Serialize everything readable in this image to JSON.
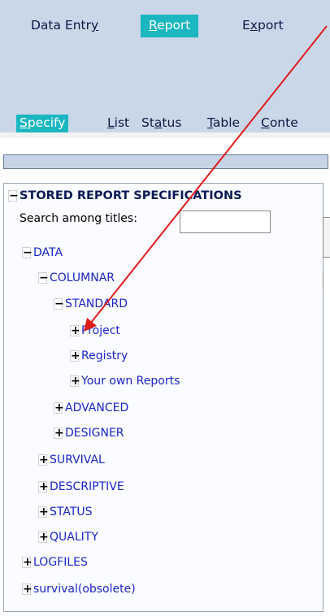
{
  "topnav": {
    "items": [
      {
        "pre": "Data Entr",
        "key": "y",
        "post": ""
      },
      {
        "pre": "",
        "key": "R",
        "post": "eport"
      },
      {
        "pre": "E",
        "key": "x",
        "post": "port"
      }
    ]
  },
  "subnav": {
    "items": [
      {
        "pre": "",
        "key": "S",
        "post": "pecify"
      },
      {
        "pre": "",
        "key": "L",
        "post": "ist"
      },
      {
        "pre": "St",
        "key": "a",
        "post": "tus"
      },
      {
        "pre": "",
        "key": "T",
        "post": "able"
      },
      {
        "pre": "",
        "key": "C",
        "post": "onte"
      }
    ]
  },
  "panel": {
    "title": "STORED REPORT SPECIFICATIONS",
    "title_toggle": "−",
    "search_label": "Search among titles:",
    "search_value": ""
  },
  "tree": [
    {
      "toggle": "−",
      "label": "DATA"
    },
    {
      "toggle": "−",
      "label": "COLUMNAR"
    },
    {
      "toggle": "−",
      "label": "STANDARD"
    },
    {
      "toggle": "+",
      "label": "Project"
    },
    {
      "toggle": "+",
      "label": "Registry"
    },
    {
      "toggle": "+",
      "label": "Your own Reports"
    },
    {
      "toggle": "+",
      "label": "ADVANCED"
    },
    {
      "toggle": "+",
      "label": "DESIGNER"
    },
    {
      "toggle": "+",
      "label": "SURVIVAL"
    },
    {
      "toggle": "+",
      "label": "DESCRIPTIVE"
    },
    {
      "toggle": "+",
      "label": "STATUS"
    },
    {
      "toggle": "+",
      "label": "QUALITY"
    },
    {
      "toggle": "+",
      "label": "LOGFILES"
    },
    {
      "toggle": "+",
      "label": "survival(obsolete)"
    }
  ],
  "colors": {
    "header_bg": "#c9d7e8",
    "active_tab": "#1bb6c0",
    "tree_link": "#1a25c8",
    "annotation_arrow": "#e01b1b"
  }
}
